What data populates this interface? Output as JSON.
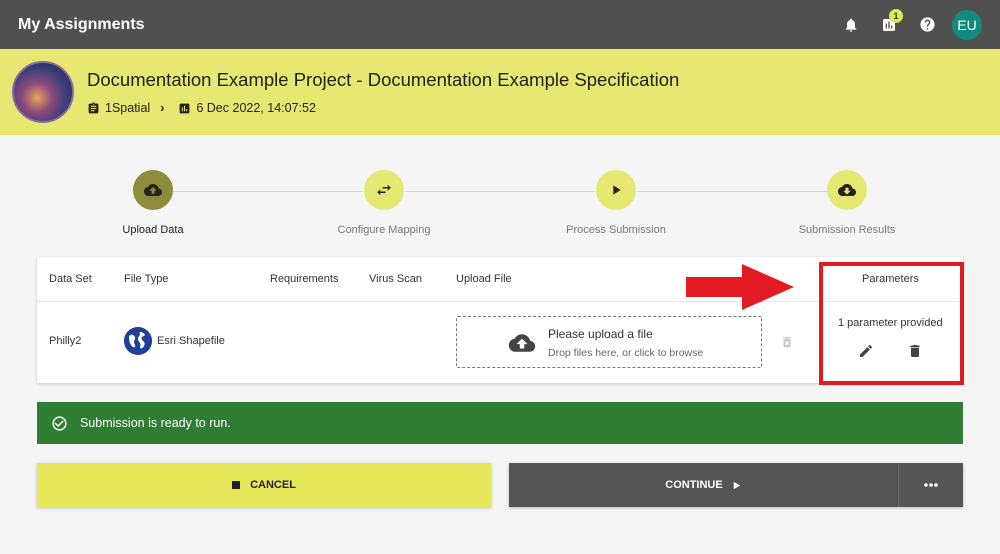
{
  "app": {
    "title": "My Assignments"
  },
  "topbar": {
    "icons": [
      "bell-icon",
      "chart-icon",
      "help-icon"
    ],
    "notification_count": "1",
    "user_initials": "EU"
  },
  "project": {
    "title": "Documentation Example Project - Documentation Example Specification",
    "organization": "1Spatial",
    "date": "6 Dec 2022, 14:07:52"
  },
  "steps": [
    {
      "label": "Upload Data",
      "icon": "cloud-upload-icon",
      "active": true
    },
    {
      "label": "Configure Mapping",
      "icon": "swap-icon",
      "active": false
    },
    {
      "label": "Process Submission",
      "icon": "play-icon",
      "active": false
    },
    {
      "label": "Submission Results",
      "icon": "cloud-download-icon",
      "active": false
    }
  ],
  "table": {
    "headers": {
      "data_set": "Data Set",
      "file_type": "File Type",
      "requirements": "Requirements",
      "virus_scan": "Virus Scan",
      "upload_file": "Upload File",
      "parameters": "Parameters"
    },
    "row": {
      "data_set": "Philly2",
      "file_type": "Esri Shapefile",
      "upload_title": "Please upload a file",
      "upload_hint": "Drop files here, or click to browse",
      "parameters_status": "1 parameter provided"
    }
  },
  "banner": {
    "message": "Submission is ready to run."
  },
  "actions": {
    "cancel_label": "CANCEL",
    "continue_label": "CONTINUE"
  },
  "colors": {
    "topbar": "#505050",
    "header": "#e6e872",
    "success": "#2e7d32",
    "highlight": "#e21b23",
    "avatar": "#118a7e"
  }
}
